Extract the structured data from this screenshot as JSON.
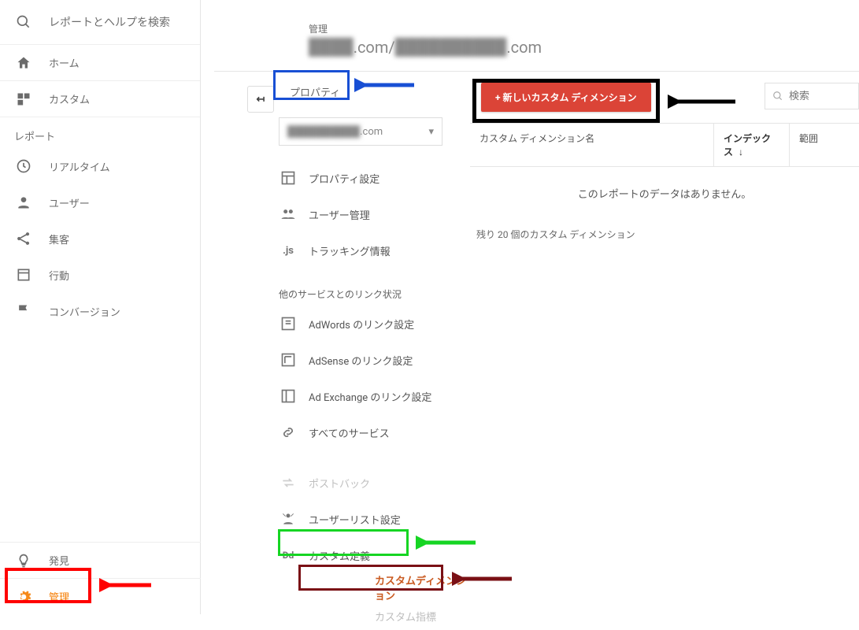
{
  "search_placeholder": "レポートとヘルプを検索",
  "nav": {
    "home": "ホーム",
    "custom": "カスタム",
    "reports_label": "レポート",
    "realtime": "リアルタイム",
    "user": "ユーザー",
    "acquire": "集客",
    "behavior": "行動",
    "conversion": "コンバージョン",
    "discover": "発見",
    "admin": "管理"
  },
  "breadcrumb": {
    "admin": "管理"
  },
  "account": {
    "domain1": ".com",
    "sep": " / ",
    "domain2": ".com",
    "blurred1": "████",
    "blurred2": "██████████"
  },
  "property": {
    "header": "プロパティ",
    "selected_blurred": "██████████",
    "selected_suffix": ".com",
    "items": {
      "settings": "プロパティ設定",
      "user_mgmt": "ユーザー管理",
      "tracking": "トラッキング情報",
      "group": "他のサービスとのリンク状況",
      "adwords": "AdWords のリンク設定",
      "adsense": "AdSense のリンク設定",
      "adexchange": "Ad Exchange のリンク設定",
      "all": "すべてのサービス",
      "postback": "ポストバック",
      "audience": "ユーザーリスト設定",
      "customdef": "カスタム定義",
      "cd": "カスタムディメンション",
      "cm": "カスタム指標"
    }
  },
  "main": {
    "new_btn": "+ 新しいカスタム ディメンション",
    "search_ph": "検索",
    "col_name": "カスタム ディメンション名",
    "col_index": "インデックス",
    "col_index_arrow": "↓",
    "col_scope": "範囲",
    "empty": "このレポートのデータはありません。",
    "remaining": "残り 20 個のカスタム ディメンション"
  }
}
